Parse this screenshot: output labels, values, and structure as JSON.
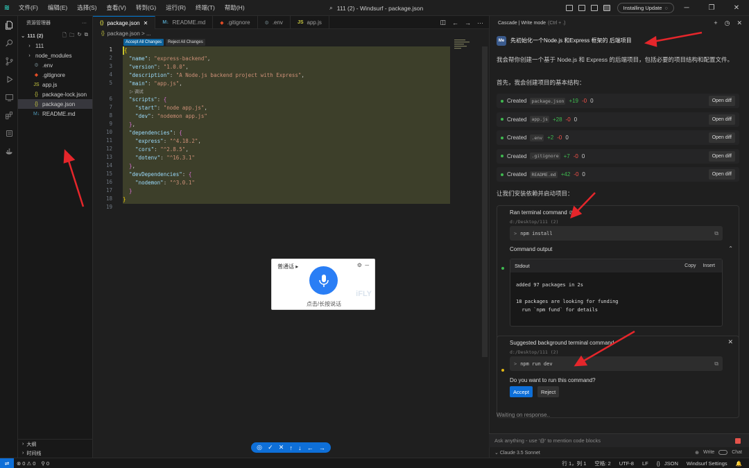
{
  "window": {
    "title": "111 (2) - Windsurf - package.json",
    "install_badge": "Installing Update"
  },
  "menu": [
    "文件(F)",
    "编辑(E)",
    "选择(S)",
    "查看(V)",
    "转到(G)",
    "运行(R)",
    "终端(T)",
    "帮助(H)"
  ],
  "sidebar": {
    "header": "资源管理器",
    "root": "111 (2)",
    "items": [
      {
        "name": "111",
        "type": "folder"
      },
      {
        "name": "node_modules",
        "type": "folder"
      },
      {
        "name": ".env",
        "type": "gear"
      },
      {
        "name": ".gitignore",
        "type": "git"
      },
      {
        "name": "app.js",
        "type": "js"
      },
      {
        "name": "package-lock.json",
        "type": "json"
      },
      {
        "name": "package.json",
        "type": "json",
        "selected": true
      },
      {
        "name": "README.md",
        "type": "md"
      }
    ],
    "outline": "大纲",
    "timeline": "时间线"
  },
  "tabs": [
    {
      "label": "package.json",
      "icon": "{}",
      "active": true
    },
    {
      "label": "README.md",
      "icon": "M↓"
    },
    {
      "label": ".gitignore",
      "icon": "◆"
    },
    {
      "label": ".env",
      "icon": "⚙"
    },
    {
      "label": "app.js",
      "icon": "JS"
    }
  ],
  "breadcrumb": "package.json > ...",
  "diff_actions": {
    "accept_all": "Accept All Changes",
    "reject_all": "Reject All Changes"
  },
  "code_lens": "▷ 调试",
  "code_lines": [
    {
      "n": "1",
      "html": "<span class='b'>{</span>"
    },
    {
      "n": "2",
      "html": "  <span class='k'>\"name\"</span><span class='p'>: </span><span class='s'>\"express-backend\"</span><span class='p'>,</span>"
    },
    {
      "n": "3",
      "html": "  <span class='k'>\"version\"</span><span class='p'>: </span><span class='s'>\"1.0.0\"</span><span class='p'>,</span>"
    },
    {
      "n": "4",
      "html": "  <span class='k'>\"description\"</span><span class='p'>: </span><span class='s'>\"A Node.js backend project with Express\"</span><span class='p'>,</span>"
    },
    {
      "n": "5",
      "html": "  <span class='k'>\"main\"</span><span class='p'>: </span><span class='s'>\"app.js\"</span><span class='p'>,</span>"
    },
    {
      "n": "6",
      "html": "  <span class='k'>\"scripts\"</span><span class='p'>: </span><span class='b2'>{</span>"
    },
    {
      "n": "7",
      "html": "    <span class='k'>\"start\"</span><span class='p'>: </span><span class='s'>\"node app.js\"</span><span class='p'>,</span>"
    },
    {
      "n": "8",
      "html": "    <span class='k'>\"dev\"</span><span class='p'>: </span><span class='s'>\"nodemon app.js\"</span>"
    },
    {
      "n": "9",
      "html": "  <span class='b2'>}</span><span class='p'>,</span>"
    },
    {
      "n": "10",
      "html": "  <span class='k'>\"dependencies\"</span><span class='p'>: </span><span class='b2'>{</span>"
    },
    {
      "n": "11",
      "html": "    <span class='k'>\"express\"</span><span class='p'>: </span><span class='s'>\"^4.18.2\"</span><span class='p'>,</span>"
    },
    {
      "n": "12",
      "html": "    <span class='k'>\"cors\"</span><span class='p'>: </span><span class='s'>\"^2.8.5\"</span><span class='p'>,</span>"
    },
    {
      "n": "13",
      "html": "    <span class='k'>\"dotenv\"</span><span class='p'>: </span><span class='s'>\"^16.3.1\"</span>"
    },
    {
      "n": "14",
      "html": "  <span class='b2'>}</span><span class='p'>,</span>"
    },
    {
      "n": "15",
      "html": "  <span class='k'>\"devDependencies\"</span><span class='p'>: </span><span class='b2'>{</span>"
    },
    {
      "n": "16",
      "html": "    <span class='k'>\"nodemon\"</span><span class='p'>: </span><span class='s'>\"^3.0.1\"</span>"
    },
    {
      "n": "17",
      "html": "  <span class='b2'>}</span>"
    },
    {
      "n": "18",
      "html": "<span class='b'>}</span>"
    },
    {
      "n": "19",
      "html": ""
    }
  ],
  "voice": {
    "lang": "普通话",
    "hint": "点击/长按说话",
    "watermark": "iFLY"
  },
  "cascade": {
    "header": "Cascade | Write mode",
    "header_shortcut": "(Ctrl + .)",
    "user_avatar": "Me",
    "user_msg": "先初始化一个Node.js 和Express 框架的 后端项目",
    "intro": "我会帮你创建一个基于 Node.js 和 Express 的后端项目，包括必要的项目结构和配置文件。",
    "first": "首先，我会创建项目的基本结构：",
    "files": [
      {
        "label": "Created",
        "file": "package.json",
        "add": "+19",
        "del": "-0",
        "zero": "0",
        "btn": "Open diff"
      },
      {
        "label": "Created",
        "file": "app.js",
        "add": "+28",
        "del": "-0",
        "zero": "0",
        "btn": "Open diff"
      },
      {
        "label": "Created",
        "file": ".env",
        "add": "+2",
        "del": "-0",
        "zero": "0",
        "btn": "Open diff"
      },
      {
        "label": "Created",
        "file": ".gitignore",
        "add": "+7",
        "del": "-0",
        "zero": "0",
        "btn": "Open diff"
      },
      {
        "label": "Created",
        "file": "README.md",
        "add": "+42",
        "del": "-0",
        "zero": "0",
        "btn": "Open diff"
      }
    ],
    "install_text": "让我们安装依赖并启动项目：",
    "ran": {
      "title": "Ran terminal command",
      "path": "d:/Desktop/111 (2)",
      "cmd": "npm install",
      "output_label": "Command output",
      "stdout": "Stdout",
      "copy": "Copy",
      "insert": "Insert",
      "lines": "added 97 packages in 2s\n\n18 packages are looking for funding\n  run `npm fund` for details"
    },
    "suggested": {
      "title": "Suggested background terminal command",
      "path": "d:/Desktop/111 (2)",
      "cmd": "npm run dev",
      "question": "Do you want to run this command?",
      "accept": "Accept",
      "reject": "Reject"
    },
    "waiting": "Waiting on response..",
    "ask_placeholder": "Ask anything - use '@' to mention code blocks",
    "model": "Claude 3.5 Sonnet",
    "write": "Write",
    "chat": "Chat"
  },
  "status": {
    "errors": "0",
    "warnings": "0",
    "ports": "0",
    "position": "行 1，列 1",
    "spaces": "空格: 2",
    "encoding": "UTF-8",
    "eol": "LF",
    "lang": "JSON",
    "settings": "Windsurf Settings"
  },
  "colors": {
    "accent": "#0e6fd8",
    "diff_bg": "#3d3f2a",
    "arrow": "#e5262b"
  }
}
